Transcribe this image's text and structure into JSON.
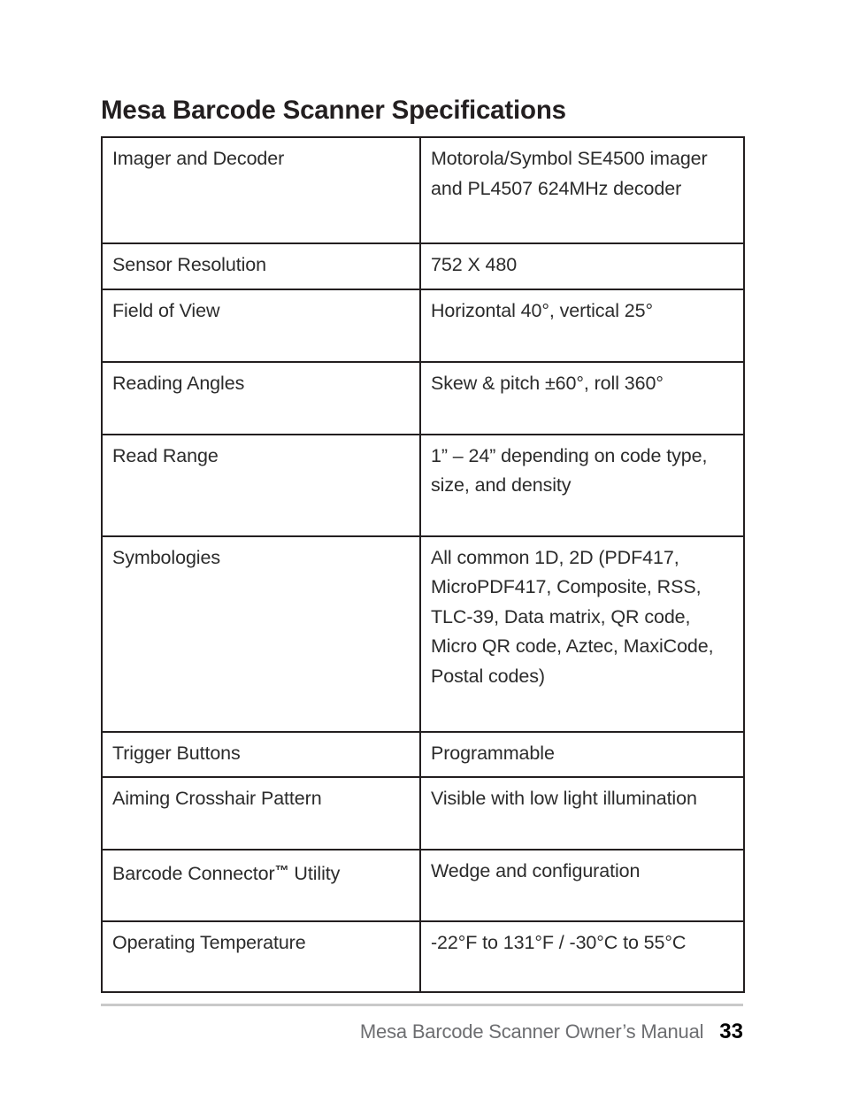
{
  "document": {
    "title": "Mesa Barcode Scanner Specifications"
  },
  "spec_table": {
    "rows": [
      {
        "label": "Imager and Decoder",
        "value": "Motorola/Symbol SE4500 imager and PL4507 624MHz decoder"
      },
      {
        "label": "Sensor Resolution",
        "value": "752 X 480"
      },
      {
        "label": "Field of View",
        "value": "Horizontal 40°, vertical 25°"
      },
      {
        "label": "Reading Angles",
        "value": "Skew & pitch ±60°, roll 360°"
      },
      {
        "label": "Read Range",
        "value": "1” – 24” depending on code type, size, and density"
      },
      {
        "label": "Symbologies",
        "value": "All common 1D, 2D (PDF417, MicroPDF417, Composite, RSS, TLC-39, Data matrix, QR code, Micro QR code, Aztec, MaxiCode, Postal codes)"
      },
      {
        "label": "Trigger Buttons",
        "value": "Programmable"
      },
      {
        "label": "Aiming Crosshair Pattern",
        "value": "Visible with low light illumination"
      },
      {
        "label_prefix": "Barcode Connector",
        "label_trademark": "™",
        "label_suffix": " Utility",
        "label": "Barcode Connector™ Utility",
        "value": "Wedge and configuration"
      },
      {
        "label": "Operating Temperature",
        "value": "-22°F to 131°F / -30°C to 55°C"
      }
    ]
  },
  "footer": {
    "manual_title": "Mesa Barcode Scanner Owner’s Manual",
    "page_number": "33"
  },
  "colors": {
    "text": "#2b2b2b",
    "heading": "#231f20",
    "border": "#231f20",
    "footer_text": "#6d6e71",
    "footer_rule": "#c9c9c9",
    "page_number": "#000000"
  }
}
